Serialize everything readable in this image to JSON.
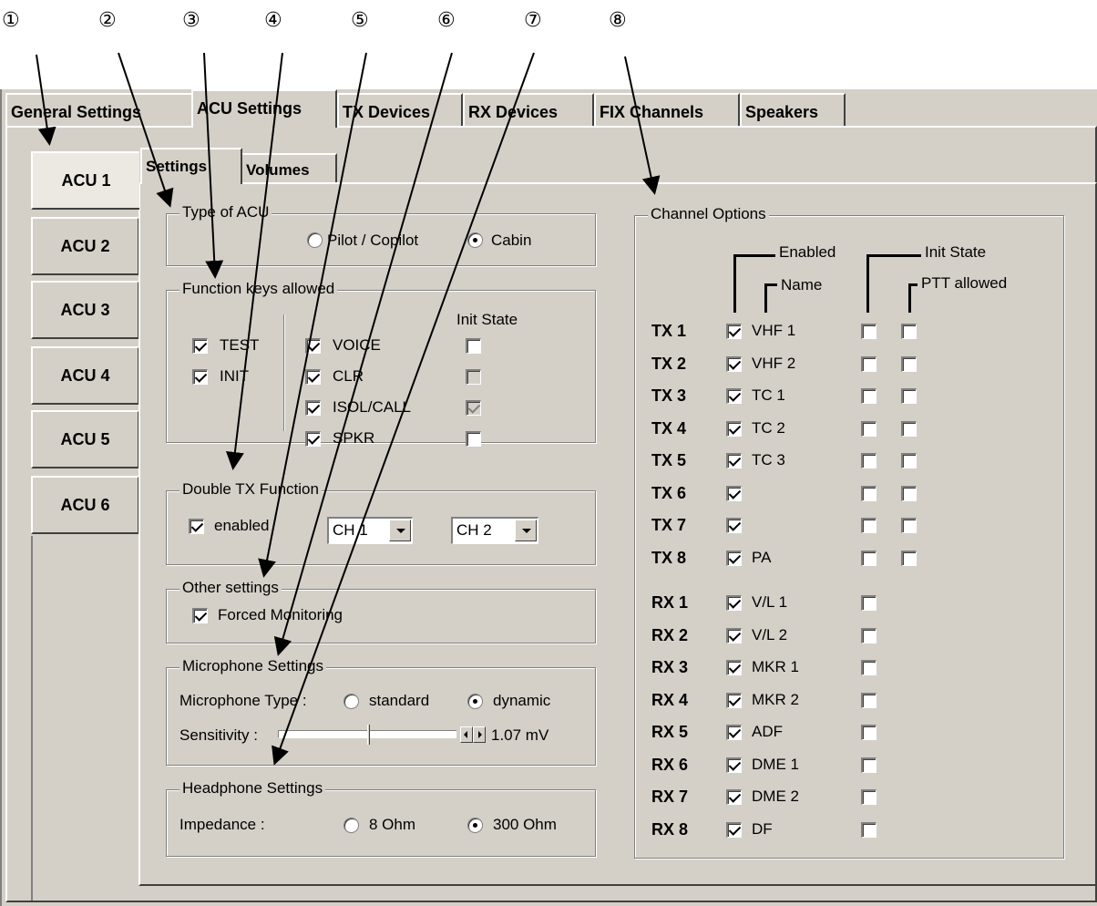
{
  "annotations": [
    "①",
    "②",
    "③",
    "④",
    "⑤",
    "⑥",
    "⑦",
    "⑧"
  ],
  "tabs": [
    "General Settings",
    "ACU Settings",
    "TX Devices",
    "RX Devices",
    "FIX Channels",
    "Speakers"
  ],
  "active_tab": "ACU Settings",
  "acu_buttons": [
    "ACU 1",
    "ACU 2",
    "ACU 3",
    "ACU 4",
    "ACU 5",
    "ACU 6"
  ],
  "active_acu": "ACU 1",
  "subtabs": [
    "Settings",
    "Volumes"
  ],
  "active_subtab": "Settings",
  "type_of_acu": {
    "title": "Type of ACU",
    "options": [
      "Pilot / Copilot",
      "Cabin"
    ],
    "selected": "Cabin"
  },
  "function_keys": {
    "title": "Function keys allowed",
    "init_state_label": "Init State",
    "left": [
      {
        "label": "TEST",
        "checked": true
      },
      {
        "label": "INIT",
        "checked": true
      }
    ],
    "right": [
      {
        "label": "VOICE",
        "checked": true,
        "init": false,
        "init_disabled": false
      },
      {
        "label": "CLR",
        "checked": true,
        "init": false,
        "init_disabled": true
      },
      {
        "label": "ISOL/CALL",
        "checked": true,
        "init": true,
        "init_disabled": true
      },
      {
        "label": "SPKR",
        "checked": true,
        "init": false,
        "init_disabled": false
      }
    ]
  },
  "double_tx": {
    "title": "Double TX Function",
    "enabled_label": "enabled",
    "enabled": true,
    "ch_a": "CH 1",
    "ch_b": "CH 2"
  },
  "other_settings": {
    "title": "Other settings",
    "forced_monitoring_label": "Forced Monitoring",
    "forced_monitoring": true
  },
  "microphone": {
    "title": "Microphone Settings",
    "type_label": "Microphone Type :",
    "options": [
      "standard",
      "dynamic"
    ],
    "selected": "dynamic",
    "sensitivity_label": "Sensitivity :",
    "sensitivity_value": "1.07 mV",
    "sensitivity_level": 0.5
  },
  "headphone": {
    "title": "Headphone Settings",
    "impedance_label": "Impedance :",
    "options": [
      "8 Ohm",
      "300 Ohm"
    ],
    "selected": "300 Ohm"
  },
  "channel_options": {
    "title": "Channel Options",
    "headers": {
      "enabled": "Enabled",
      "name": "Name",
      "init_state": "Init State",
      "ptt_allowed": "PTT allowed"
    },
    "tx": [
      {
        "id": "TX 1",
        "name": "VHF 1"
      },
      {
        "id": "TX 2",
        "name": "VHF 2"
      },
      {
        "id": "TX 3",
        "name": "TC 1"
      },
      {
        "id": "TX 4",
        "name": "TC 2"
      },
      {
        "id": "TX 5",
        "name": "TC 3"
      },
      {
        "id": "TX 6",
        "name": ""
      },
      {
        "id": "TX 7",
        "name": ""
      },
      {
        "id": "TX 8",
        "name": "PA"
      }
    ],
    "rx": [
      {
        "id": "RX 1",
        "name": "V/L 1"
      },
      {
        "id": "RX 2",
        "name": "V/L 2"
      },
      {
        "id": "RX 3",
        "name": "MKR 1"
      },
      {
        "id": "RX 4",
        "name": "MKR 2"
      },
      {
        "id": "RX 5",
        "name": "ADF"
      },
      {
        "id": "RX 6",
        "name": "DME 1"
      },
      {
        "id": "RX 7",
        "name": "DME 2"
      },
      {
        "id": "RX 8",
        "name": "DF"
      }
    ]
  }
}
